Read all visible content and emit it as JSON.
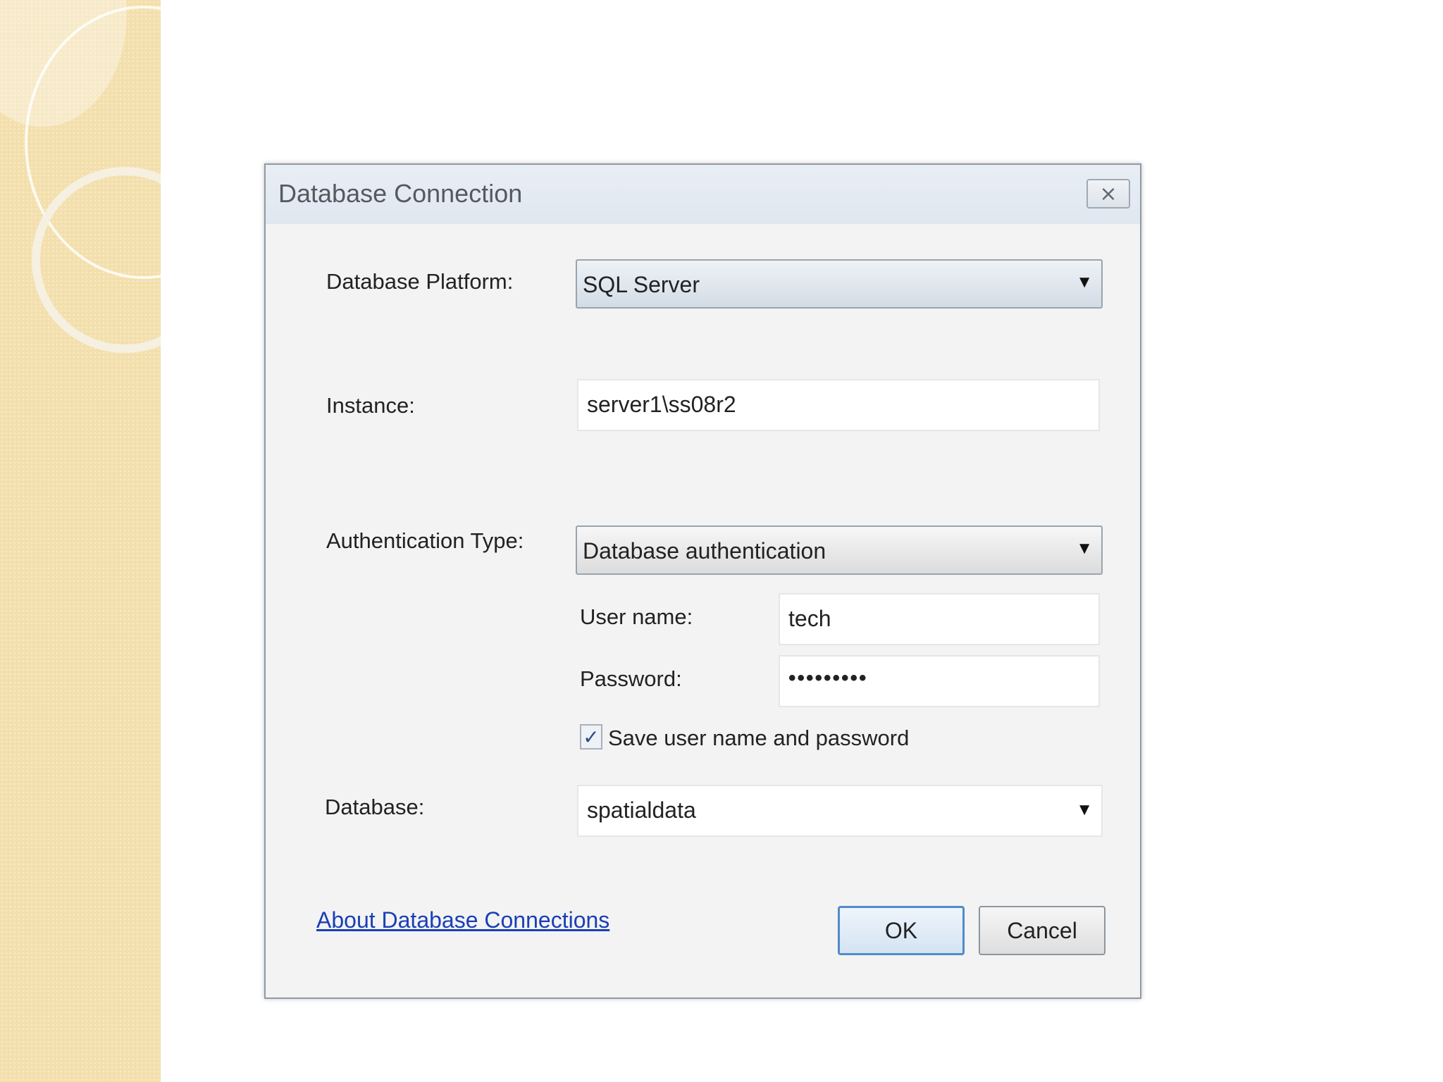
{
  "dialog": {
    "title": "Database Connection",
    "close_symbol": "⨯"
  },
  "platform": {
    "label": "Database Platform:",
    "value": "SQL Server"
  },
  "instance": {
    "label": "Instance:",
    "value": "server1\\ss08r2"
  },
  "auth": {
    "label": "Authentication Type:",
    "value": "Database authentication",
    "username_label": "User name:",
    "username_value": "tech",
    "password_label": "Password:",
    "password_value": "•••••••••",
    "save_checkbox_label": "Save user name and password",
    "save_checked": true,
    "check_mark": "✓"
  },
  "database": {
    "label": "Database:",
    "value": "spatialdata"
  },
  "footer": {
    "about_link": "About Database Connections",
    "ok_label": "OK",
    "cancel_label": "Cancel"
  },
  "icons": {
    "dropdown_arrow": "▼"
  }
}
